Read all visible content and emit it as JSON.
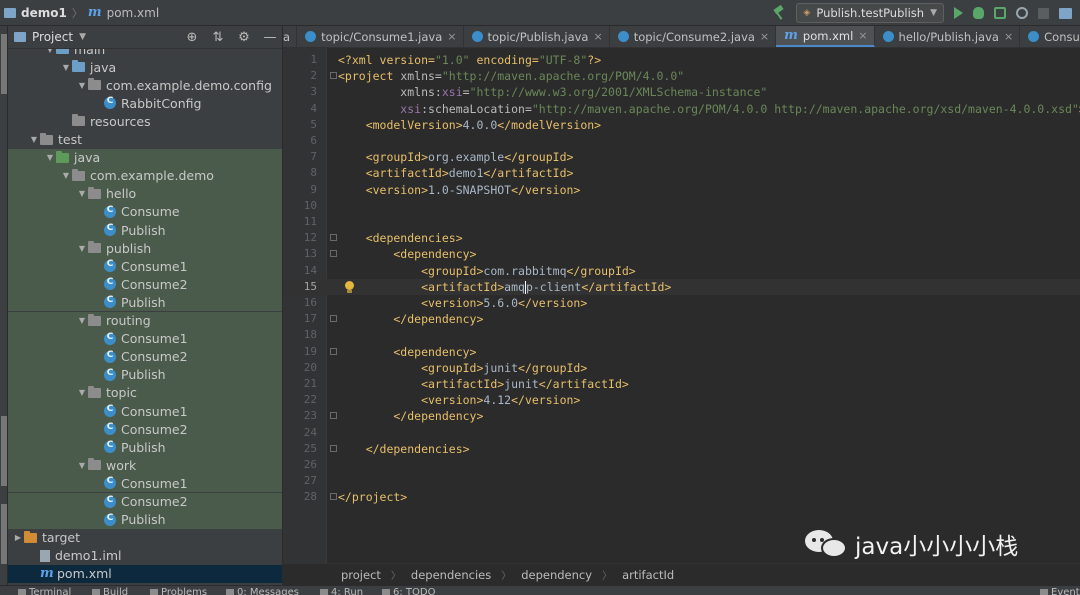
{
  "titlebar": {
    "project": "demo1",
    "file": "pom.xml",
    "run_config": "Publish.testPublish"
  },
  "project_panel": {
    "title": "Project",
    "tree": [
      {
        "label": "main",
        "type": "folder-blue",
        "depth": 3,
        "arrow": "down"
      },
      {
        "label": "java",
        "type": "folder-blue",
        "depth": 4,
        "arrow": "down"
      },
      {
        "label": "com.example.demo.config",
        "type": "package",
        "depth": 5,
        "arrow": "down"
      },
      {
        "label": "RabbitConfig",
        "type": "class",
        "depth": 6,
        "arrow": ""
      },
      {
        "label": "resources",
        "type": "folder-grey",
        "depth": 4,
        "arrow": ""
      },
      {
        "label": "test",
        "type": "folder-grey",
        "depth": 2,
        "arrow": "down"
      },
      {
        "label": "java",
        "type": "folder-green",
        "depth": 3,
        "arrow": "down",
        "hl": true
      },
      {
        "label": "com.example.demo",
        "type": "package",
        "depth": 4,
        "arrow": "down",
        "hl": true
      },
      {
        "label": "hello",
        "type": "package",
        "depth": 5,
        "arrow": "down",
        "hl": true
      },
      {
        "label": "Consume",
        "type": "class",
        "depth": 6,
        "arrow": "",
        "hl": true
      },
      {
        "label": "Publish",
        "type": "class",
        "depth": 6,
        "arrow": "",
        "hl": true
      },
      {
        "label": "publish",
        "type": "package",
        "depth": 5,
        "arrow": "down",
        "hl": true
      },
      {
        "label": "Consume1",
        "type": "class",
        "depth": 6,
        "arrow": "",
        "hl": true
      },
      {
        "label": "Consume2",
        "type": "class",
        "depth": 6,
        "arrow": "",
        "hl": true
      },
      {
        "label": "Publish",
        "type": "class",
        "depth": 6,
        "arrow": "",
        "hl": true
      },
      {
        "label": "routing",
        "type": "package",
        "depth": 5,
        "arrow": "down",
        "hl": true
      },
      {
        "label": "Consume1",
        "type": "class",
        "depth": 6,
        "arrow": "",
        "hl": true
      },
      {
        "label": "Consume2",
        "type": "class",
        "depth": 6,
        "arrow": "",
        "hl": true
      },
      {
        "label": "Publish",
        "type": "class",
        "depth": 6,
        "arrow": "",
        "hl": true
      },
      {
        "label": "topic",
        "type": "package",
        "depth": 5,
        "arrow": "down",
        "hl": true
      },
      {
        "label": "Consume1",
        "type": "class",
        "depth": 6,
        "arrow": "",
        "hl": true
      },
      {
        "label": "Consume2",
        "type": "class",
        "depth": 6,
        "arrow": "",
        "hl": true
      },
      {
        "label": "Publish",
        "type": "class",
        "depth": 6,
        "arrow": "",
        "hl": true
      },
      {
        "label": "work",
        "type": "package",
        "depth": 5,
        "arrow": "down",
        "hl": true
      },
      {
        "label": "Consume1",
        "type": "class",
        "depth": 6,
        "arrow": "",
        "hl": true
      },
      {
        "label": "Consume2",
        "type": "class",
        "depth": 6,
        "arrow": "",
        "hl": true
      },
      {
        "label": "Publish",
        "type": "class",
        "depth": 6,
        "arrow": "",
        "hl": true
      },
      {
        "label": "target",
        "type": "folder-orange",
        "depth": 1,
        "arrow": "right"
      },
      {
        "label": "demo1.iml",
        "type": "iml",
        "depth": 2,
        "arrow": ""
      },
      {
        "label": "pom.xml",
        "type": "pom",
        "depth": 2,
        "arrow": "",
        "sel": true
      }
    ]
  },
  "tabs": [
    {
      "label": "a",
      "active": false,
      "icon": false
    },
    {
      "label": "topic/Consume1.java",
      "active": false,
      "icon": true
    },
    {
      "label": "topic/Publish.java",
      "active": false,
      "icon": true
    },
    {
      "label": "topic/Consume2.java",
      "active": false,
      "icon": true
    },
    {
      "label": "pom.xml",
      "active": true,
      "icon": "m"
    },
    {
      "label": "hello/Publish.java",
      "active": false,
      "icon": true
    },
    {
      "label": "Consume.java",
      "active": false,
      "icon": true
    },
    {
      "label": "",
      "active": false,
      "icon": true
    }
  ],
  "editor": {
    "current_line": 15,
    "lines": [
      [
        [
          "pi",
          "<?xml version="
        ],
        [
          "val",
          "\"1.0\""
        ],
        [
          "pi",
          " encoding="
        ],
        [
          "val",
          "\"UTF-8\""
        ],
        [
          "pi",
          "?>"
        ]
      ],
      [
        [
          "tag",
          "<project "
        ],
        [
          "attr",
          "xmlns="
        ],
        [
          "val",
          "\"http://maven.apache.org/POM/4.0.0\""
        ]
      ],
      [
        [
          "attr",
          "         xmlns:"
        ],
        [
          "ns",
          "xsi"
        ],
        [
          "attr",
          "="
        ],
        [
          "val",
          "\"http://www.w3.org/2001/XMLSchema-instance\""
        ]
      ],
      [
        [
          "ns",
          "         xsi"
        ],
        [
          "attr",
          ":schemaLocation="
        ],
        [
          "val",
          "\"http://maven.apache.org/POM/4.0.0 http://maven.apache.org/xsd/maven-4.0.0.xsd\""
        ],
        [
          "tag",
          ">"
        ]
      ],
      [
        [
          "tag",
          "    <modelVersion>"
        ],
        [
          "txt",
          "4.0.0"
        ],
        [
          "tag",
          "</modelVersion>"
        ]
      ],
      [],
      [
        [
          "tag",
          "    <groupId>"
        ],
        [
          "txt",
          "org.example"
        ],
        [
          "tag",
          "</groupId>"
        ]
      ],
      [
        [
          "tag",
          "    <artifactId>"
        ],
        [
          "txt",
          "demo1"
        ],
        [
          "tag",
          "</artifactId>"
        ]
      ],
      [
        [
          "tag",
          "    <version>"
        ],
        [
          "txt",
          "1.0-SNAPSHOT"
        ],
        [
          "tag",
          "</version>"
        ]
      ],
      [],
      [],
      [
        [
          "tag",
          "    <dependencies>"
        ]
      ],
      [
        [
          "tag",
          "        <dependency>"
        ]
      ],
      [
        [
          "tag",
          "            <groupId>"
        ],
        [
          "txt",
          "com.rabbitmq"
        ],
        [
          "tag",
          "</groupId>"
        ]
      ],
      [
        [
          "tag",
          "            <artifactId>"
        ],
        [
          "txt",
          "amqp-client"
        ],
        [
          "tag",
          "</artifactId>"
        ]
      ],
      [
        [
          "tag",
          "            <version>"
        ],
        [
          "txt",
          "5.6.0"
        ],
        [
          "tag",
          "</version>"
        ]
      ],
      [
        [
          "tag",
          "        </dependency>"
        ]
      ],
      [],
      [
        [
          "tag",
          "        <dependency>"
        ]
      ],
      [
        [
          "tag",
          "            <groupId>"
        ],
        [
          "txt",
          "junit"
        ],
        [
          "tag",
          "</groupId>"
        ]
      ],
      [
        [
          "tag",
          "            <artifactId>"
        ],
        [
          "txt",
          "junit"
        ],
        [
          "tag",
          "</artifactId>"
        ]
      ],
      [
        [
          "tag",
          "            <version>"
        ],
        [
          "txt",
          "4.12"
        ],
        [
          "tag",
          "</version>"
        ]
      ],
      [
        [
          "tag",
          "        </dependency>"
        ]
      ],
      [],
      [
        [
          "tag",
          "    </dependencies>"
        ]
      ],
      [],
      [],
      [
        [
          "tag",
          "</project>"
        ]
      ]
    ]
  },
  "breadcrumb": [
    "project",
    "dependencies",
    "dependency",
    "artifactId"
  ],
  "watermark": "java小小小小栈",
  "statusbar": [
    {
      "label": "Terminal",
      "name": "terminal"
    },
    {
      "label": "Build",
      "name": "build"
    },
    {
      "label": "Problems",
      "name": "problems"
    },
    {
      "label": "0: Messages",
      "name": "messages"
    },
    {
      "label": "4: Run",
      "name": "run"
    },
    {
      "label": "6: TODO",
      "name": "todo"
    },
    {
      "label": "Event",
      "name": "event-log"
    }
  ],
  "colors": {
    "tag": "#e8bf6a",
    "value": "#6a8759",
    "text": "#a9b7c6",
    "namespace": "#9876aa",
    "selection": "#0d293e",
    "test_highlight": "#4b5b4b"
  }
}
